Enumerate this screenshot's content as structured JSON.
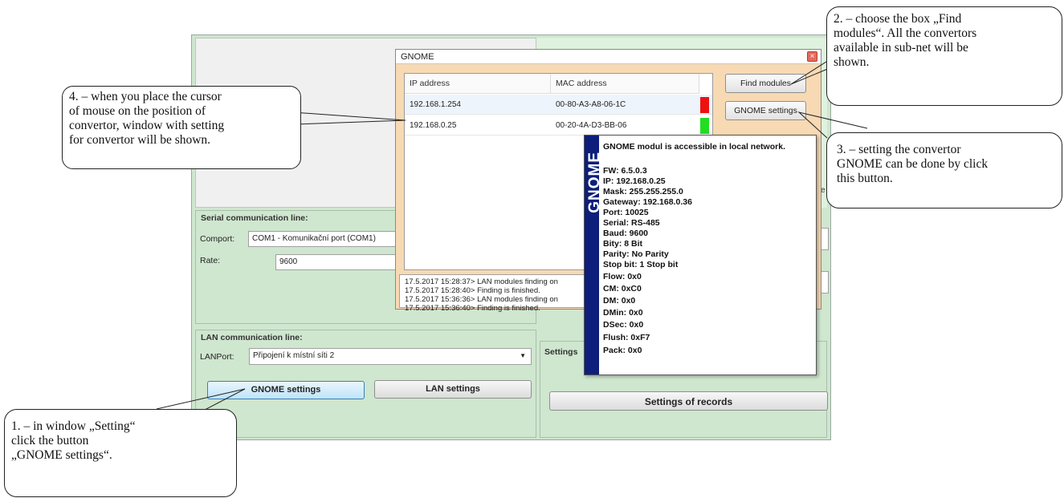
{
  "gnome_dialog": {
    "title": "GNOME",
    "columns": [
      "IP address",
      "MAC address"
    ],
    "rows": [
      {
        "ip": "192.168.1.254",
        "mac": "00-80-A3-A8-06-1C",
        "status_color": "#ee1111"
      },
      {
        "ip": "192.168.0.25",
        "mac": "00-20-4A-D3-BB-06",
        "status_color": "#22dd22"
      }
    ],
    "find_button": "Find modules",
    "settings_button": "GNOME settings",
    "log": [
      "17.5.2017 15:28:37> LAN modules finding on",
      "17.5.2017 15:28:40> Finding is finished.",
      "17.5.2017 15:36:36> LAN modules finding on",
      "17.5.2017 15:36:40> Finding is finished."
    ],
    "side_edge_char": "e"
  },
  "tooltip": {
    "brand": "GNOME",
    "header": "GNOME modul is accessible in local network.",
    "lines": [
      "FW: 6.5.0.3",
      "IP: 192.168.0.25",
      "Mask: 255.255.255.0",
      "Gateway: 192.168.0.36",
      "Port: 10025",
      "Serial: RS-485",
      "Baud: 9600",
      "Bity: 8 Bit",
      "Parity: No Parity",
      "Stop bit: 1 Stop bit",
      "Flow: 0x0",
      "CM: 0xC0",
      "DM: 0x0",
      "DMin: 0x0",
      "DSec: 0x0",
      "Flush: 0xF7",
      "Pack: 0x0"
    ]
  },
  "serial": {
    "title": "Serial communication line:",
    "comport_label": "Comport:",
    "comport_value": "COM1 - Komunikační port (COM1)",
    "rate_label": "Rate:",
    "rate_value": "9600"
  },
  "lan": {
    "title": "LAN communication line:",
    "port_label": "LANPort:",
    "port_value": "Připojení k místní síti 2",
    "gnome_button": "GNOME settings",
    "lan_button": "LAN settings"
  },
  "settings_group": {
    "title": "Settings",
    "records_button": "Settings of records"
  },
  "callouts": {
    "c1": [
      "1. – in window „Setting“",
      "click the button",
      "„GNOME settings“."
    ],
    "c2": [
      "2. – choose the box „Find",
      "modules“. All the convertors",
      "available in sub-net will be",
      "shown."
    ],
    "c3": [
      "3. – setting the convertor",
      "GNOME can be done by click",
      "this button."
    ],
    "c4": [
      "4. – when you place the cursor",
      "of mouse on the position of",
      "convertor, window with setting",
      "for convertor will be shown."
    ]
  }
}
